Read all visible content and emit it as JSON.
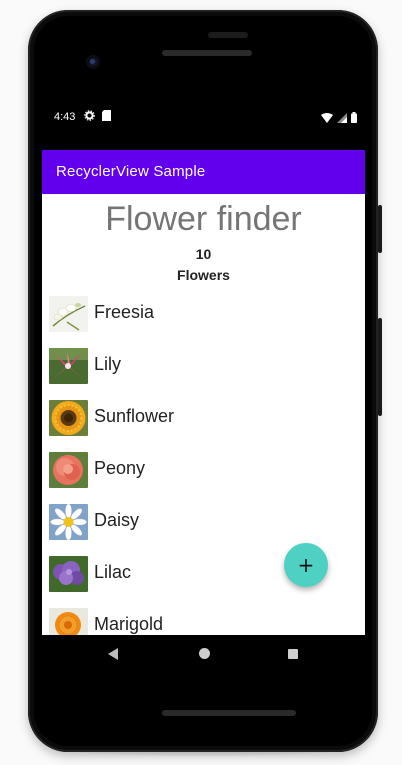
{
  "status_bar": {
    "time": "4:43",
    "icons_left": [
      "settings-gear-icon",
      "sd-card-icon"
    ],
    "icons_right": [
      "wifi-icon",
      "cell-signal-icon",
      "battery-icon"
    ]
  },
  "app_bar": {
    "title": "RecyclerView Sample",
    "color": "#6200ee"
  },
  "header": {
    "title": "Flower finder",
    "count": "10",
    "count_label": "Flowers"
  },
  "flowers": [
    {
      "name": "Freesia",
      "image_icon": "freesia-thumbnail-icon"
    },
    {
      "name": "Lily",
      "image_icon": "lily-thumbnail-icon"
    },
    {
      "name": "Sunflower",
      "image_icon": "sunflower-thumbnail-icon"
    },
    {
      "name": "Peony",
      "image_icon": "peony-thumbnail-icon"
    },
    {
      "name": "Daisy",
      "image_icon": "daisy-thumbnail-icon"
    },
    {
      "name": "Lilac",
      "image_icon": "lilac-thumbnail-icon"
    },
    {
      "name": "Marigold",
      "image_icon": "marigold-thumbnail-icon"
    }
  ],
  "fab": {
    "label": "+",
    "color": "#4ed0c3"
  },
  "nav_bar": {
    "icons": [
      "back-icon",
      "home-icon",
      "recents-icon"
    ]
  }
}
